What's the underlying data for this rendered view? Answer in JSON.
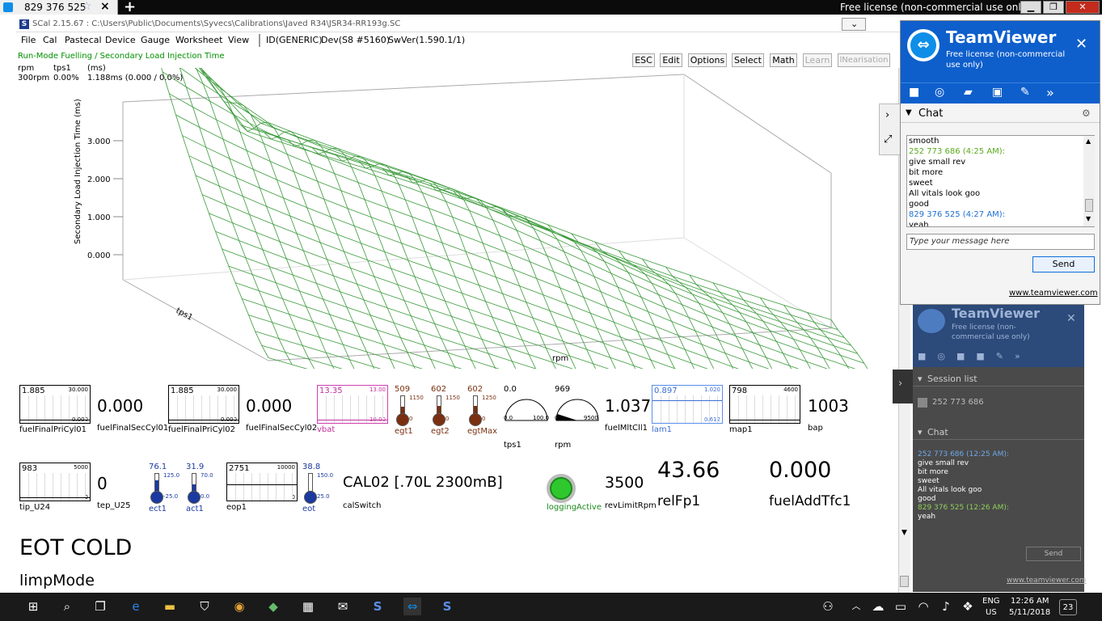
{
  "tabbar": {
    "tab_title": "829 376 525",
    "close": "×",
    "new_tab": "+",
    "license": "Free license (non-commercial use only)"
  },
  "scal": {
    "title": "SCal 2.15.67  :  C:\\Users\\Public\\Documents\\Syvecs\\Calibrations\\Javed R34\\JSR34-RR193g.SC",
    "menu": [
      "File",
      "Cal",
      "Pastecal",
      "Device",
      "Gauge",
      "Worksheet",
      "View"
    ],
    "device_id": "ID(GENERIC)",
    "device_dev": "Dev(S8 #5160)",
    "device_swver": "SwVer(1.590.1/1)",
    "map_title": "Run-Mode Fuelling / Secondary Load Injection Time",
    "readout_labels": [
      "rpm",
      "tps1",
      "(ms)"
    ],
    "readout_values": [
      "300rpm",
      "0.00%",
      "1.188ms (0.000 / 0.0%)"
    ],
    "toolbar": [
      "ESC",
      "Edit",
      "Options",
      "Select",
      "Math",
      "Learn",
      "lNearisation"
    ]
  },
  "chart_data": {
    "type": "surface",
    "zlabel": "Secondary Load Injection Time (ms)",
    "xlabel": "rpm",
    "ylabel": "tps1",
    "z_ticks": [
      "0.000",
      "1.000",
      "2.000",
      "3.000"
    ],
    "zlim": [
      0,
      3.6
    ]
  },
  "gauges": {
    "row1": [
      {
        "type": "trend",
        "value": "1.885",
        "max": "30.000",
        "min": "0.000",
        "label": "fuelFinalPriCyl01"
      },
      {
        "type": "number",
        "value": "0.000",
        "label": "fuelFinalSecCyl01"
      },
      {
        "type": "trend",
        "value": "1.885",
        "max": "30.000",
        "min": "0.000",
        "label": "fuelFinalPriCyl02"
      },
      {
        "type": "number",
        "value": "0.000",
        "label": "fuelFinalSecCyl02"
      },
      {
        "type": "trend",
        "value": "13.35",
        "max": "13.00",
        "min": "10.00",
        "label": "vbat"
      },
      {
        "type": "thermo",
        "value": "509",
        "max": "1150",
        "min": "0",
        "label": "egt1",
        "level": 0.44
      },
      {
        "type": "thermo",
        "value": "602",
        "max": "1150",
        "min": "0",
        "label": "egt2",
        "level": 0.52
      },
      {
        "type": "thermo",
        "value": "602",
        "max": "1250",
        "min": "0",
        "label": "egtMax",
        "level": 0.48
      },
      {
        "type": "dial",
        "value": "0.0",
        "min": "0.0",
        "max": "100.0",
        "label": "tps1",
        "level": 0.0
      },
      {
        "type": "dial",
        "value": "969",
        "min": "0",
        "max": "9500",
        "label": "rpm",
        "level": 0.1
      },
      {
        "type": "number",
        "value": "1.037",
        "label": "fuelMltCll1"
      },
      {
        "type": "trend",
        "value": "0.897",
        "max": "1.020",
        "min": "0.612",
        "label": "lam1"
      },
      {
        "type": "trend",
        "value": "798",
        "max": "4600",
        "min": "",
        "label": "map1"
      },
      {
        "type": "number",
        "value": "1003",
        "label": "bap"
      }
    ],
    "row2": [
      {
        "type": "trend",
        "value": "983",
        "max": "5000",
        "min": "0",
        "label": "tip_U24"
      },
      {
        "type": "number",
        "value": "0",
        "label": "tep_U25"
      },
      {
        "type": "thermo",
        "value": "76.1",
        "max": "125.0",
        "min": "-25.0",
        "label": "ect1",
        "level": 0.67
      },
      {
        "type": "thermo",
        "value": "31.9",
        "max": "70.0",
        "min": "0.0",
        "label": "act1",
        "level": 0.46
      },
      {
        "type": "trend",
        "value": "2751",
        "max": "10000",
        "min": "0",
        "label": "eop1"
      },
      {
        "type": "thermo",
        "value": "38.8",
        "max": "150.0",
        "min": "25.0",
        "label": "eot",
        "level": 0.11
      },
      {
        "type": "text",
        "value": "CAL02 [.70L 2300mB]",
        "label": "calSwitch"
      },
      {
        "type": "led",
        "label": "loggingActive"
      },
      {
        "type": "number",
        "value": "3500",
        "label": "revLimitRpm"
      },
      {
        "type": "number",
        "value": "43.66",
        "label": "relFp1"
      },
      {
        "type": "number",
        "value": "0.000",
        "label": "fuelAddTfc1"
      }
    ],
    "eot_status": "EOT COLD",
    "limp": "limpMode"
  },
  "teamviewer": {
    "brand": "TeamViewer",
    "license": "Free license (non-commercial use only)",
    "chat_title": "Chat",
    "messages": [
      {
        "text": "smooth",
        "color": "#000000"
      },
      {
        "text": "252 773 686 (4:25 AM):",
        "color": "#5aaa1e"
      },
      {
        "text": "give small rev",
        "color": "#000000"
      },
      {
        "text": "bit more",
        "color": "#000000"
      },
      {
        "text": "sweet",
        "color": "#000000"
      },
      {
        "text": "All vitals look goo",
        "color": "#000000"
      },
      {
        "text": "good",
        "color": "#000000"
      },
      {
        "text": "829 376 525 (4:27 AM):",
        "color": "#1e6ed2"
      },
      {
        "text": "yeah",
        "color": "#000000"
      }
    ],
    "input_placeholder": "Type your message here",
    "send": "Send",
    "link": "www.teamviewer.com"
  },
  "teamviewer_ghost": {
    "brand": "TeamViewer",
    "license": "Free license (non-commercial use only)",
    "session_list": "Session list",
    "session_id": "252 773 686",
    "chat_title": "Chat",
    "messages": [
      {
        "text": "252 773 686 (12:25 AM):",
        "color": "#6fa8e8"
      },
      {
        "text": "give small rev",
        "color": "#ffffff"
      },
      {
        "text": "bit more",
        "color": "#ffffff"
      },
      {
        "text": "sweet",
        "color": "#ffffff"
      },
      {
        "text": "All vitals look goo",
        "color": "#ffffff"
      },
      {
        "text": "good",
        "color": "#ffffff"
      },
      {
        "text": "829 376 525 (12:26 AM):",
        "color": "#8fcf5a"
      },
      {
        "text": "yeah",
        "color": "#ffffff"
      }
    ],
    "send": "Send",
    "link": "www.teamviewer.com"
  },
  "taskbar": {
    "lang1": "ENG",
    "lang2": "US",
    "time": "12:26 AM",
    "date": "5/11/2018",
    "notifications": "23"
  }
}
